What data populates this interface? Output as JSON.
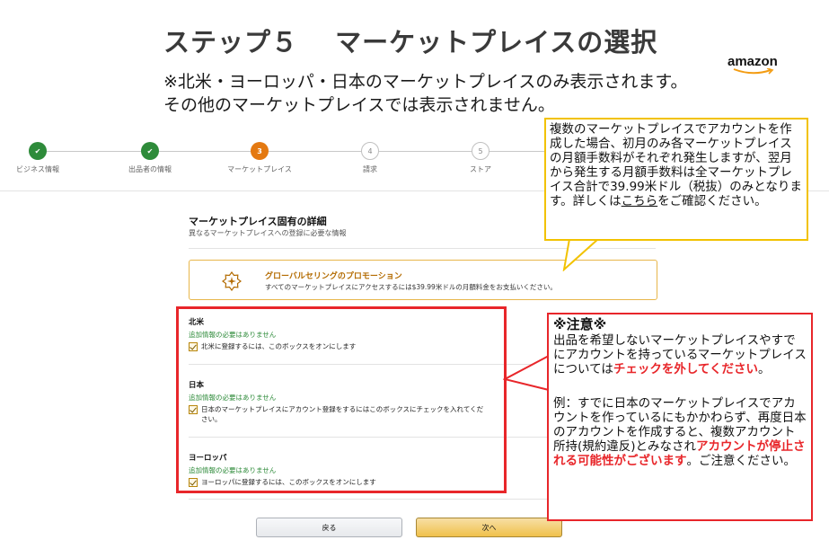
{
  "heading": {
    "title": "ステップ５　 マーケットプレイスの選択",
    "subtitle_line1": "※北米・ヨーロッパ・日本のマーケットプレイスのみ表示されます。",
    "subtitle_line2": "その他のマーケットプレイスでは表示されません。"
  },
  "logo": {
    "text": "amazon"
  },
  "stepper": {
    "steps": [
      {
        "number": "1",
        "label": "ビジネス情報",
        "state": "done"
      },
      {
        "number": "2",
        "label": "出品者の情報",
        "state": "done"
      },
      {
        "number": "3",
        "label": "マーケットプレイス",
        "state": "active"
      },
      {
        "number": "4",
        "label": "請求",
        "state": "todo"
      },
      {
        "number": "5",
        "label": "ストア",
        "state": "todo"
      }
    ]
  },
  "section": {
    "title": "マーケットプレイス固有の詳細",
    "subtitle": "異なるマーケットプレイスへの登録に必要な情報"
  },
  "promo": {
    "icon": "sparkle-badge-icon",
    "title": "グローバルセリングのプロモーション",
    "description": "すべてのマーケットプレイスにアクセスするには$39.99米ドルの月額料金をお支払いください。"
  },
  "markets": [
    {
      "name": "北米",
      "note": "追加情報の必要はありません",
      "checkbox_label": "北米に登録するには、このボックスをオンにします",
      "checked": true
    },
    {
      "name": "日本",
      "note": "追加情報の必要はありません",
      "checkbox_label": "日本のマーケットプレイスにアカウント登録をするにはこのボックスにチェックを入れてください。",
      "checked": true
    },
    {
      "name": "ヨーロッパ",
      "note": "追加情報の必要はありません",
      "checkbox_label": "ヨーロッパに登録するには、このボックスをオンにします",
      "checked": true
    }
  ],
  "buttons": {
    "back": "戻る",
    "next": "次へ"
  },
  "callout_fee": {
    "text_before_link": "複数のマーケットプレイスでアカウントを作成した場合、初月のみ各マーケットプレイスの月額手数料がそれぞれ発生しますが、翌月から発生する月額手数料は全マーケットプレイス合計で39.99米ドル（税抜）のみとなります。詳しくは",
    "link": "こちら",
    "text_after_link": "をご確認ください。"
  },
  "callout_note": {
    "heading": "※注意※",
    "p1_a": "出品を希望しないマーケットプレイスやすでにアカウントを持っているマーケットプレイスについては",
    "p1_red": "チェックを外してください",
    "p1_b": "。",
    "p2_a": "例：すでに日本のマーケットプレイスでアカウントを作っているにもかかわらず、再度日本のアカウントを作成すると、複数アカウント所持(規約違反)とみなされ",
    "p2_red": "アカウントが停止される可能性がございます",
    "p2_b": "。ご注意ください。"
  },
  "colors": {
    "accent": "#e47911",
    "done": "#2e8b3a",
    "warning_red": "#e8262a",
    "callout_yellow": "#f2c200"
  }
}
